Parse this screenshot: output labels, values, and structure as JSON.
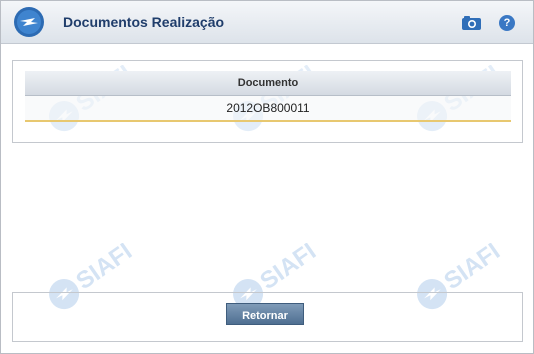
{
  "window": {
    "title": "Documentos Realização"
  },
  "toolbar": {
    "camera_icon": "camera-icon",
    "help_label": "?"
  },
  "table": {
    "columns": [
      "Documento"
    ],
    "rows": [
      [
        "2012OB800011"
      ]
    ]
  },
  "footer": {
    "retornar_label": "Retornar"
  },
  "watermark": {
    "text": "SIAFI"
  },
  "colors": {
    "title": "#1f3d6b",
    "accent": "#3a78c4",
    "button": "#5a7899",
    "row_highlight": "#e8c870"
  }
}
